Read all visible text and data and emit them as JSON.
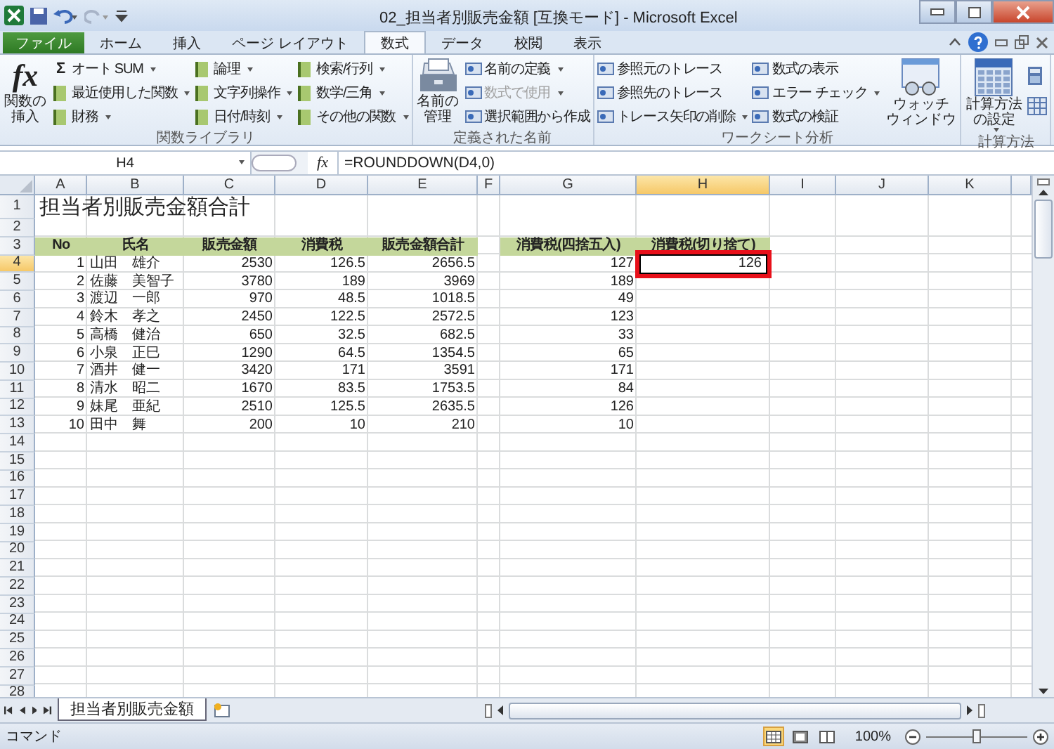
{
  "window": {
    "title": "02_担当者別販売金額 [互換モード] - Microsoft Excel"
  },
  "tabs": [
    {
      "label": "ファイル",
      "kind": "file",
      "selected": false
    },
    {
      "label": "ホーム",
      "kind": "tab",
      "selected": false
    },
    {
      "label": "挿入",
      "kind": "tab",
      "selected": false
    },
    {
      "label": "ページ レイアウト",
      "kind": "tab",
      "selected": false
    },
    {
      "label": "数式",
      "kind": "tab",
      "selected": true
    },
    {
      "label": "データ",
      "kind": "tab",
      "selected": false
    },
    {
      "label": "校閲",
      "kind": "tab",
      "selected": false
    },
    {
      "label": "表示",
      "kind": "tab",
      "selected": false
    }
  ],
  "ribbon": [
    {
      "label": "関数ライブラリ",
      "items": [
        {
          "kind": "large",
          "glyph": "fx",
          "lines": [
            "関数の",
            "挿入"
          ],
          "dropdown": false
        },
        {
          "kind": "column",
          "entries": [
            {
              "glyph": "Σ",
              "label": "オート SUM",
              "dropdown": true,
              "disabled": false
            },
            {
              "label": "最近使用した関数",
              "dropdown": true,
              "disabled": false
            },
            {
              "label": "財務",
              "dropdown": true,
              "disabled": false
            }
          ]
        },
        {
          "kind": "column",
          "entries": [
            {
              "label": "論理",
              "dropdown": true,
              "disabled": false
            },
            {
              "label": "文字列操作",
              "dropdown": true,
              "disabled": false
            },
            {
              "label": "日付/時刻",
              "dropdown": true,
              "disabled": false
            }
          ]
        },
        {
          "kind": "column",
          "entries": [
            {
              "label": "検索/行列",
              "dropdown": true,
              "disabled": false
            },
            {
              "label": "数学/三角",
              "dropdown": true,
              "disabled": false
            },
            {
              "label": "その他の関数",
              "dropdown": true,
              "disabled": false
            }
          ]
        }
      ]
    },
    {
      "label": "定義された名前",
      "items": [
        {
          "kind": "large",
          "lines": [
            "名前の",
            "管理"
          ],
          "dropdown": false
        },
        {
          "kind": "column",
          "entries": [
            {
              "label": "名前の定義",
              "dropdown": true,
              "disabled": false
            },
            {
              "label": "数式で使用",
              "dropdown": true,
              "disabled": true
            },
            {
              "label": "選択範囲から作成",
              "dropdown": false,
              "disabled": false
            }
          ]
        }
      ]
    },
    {
      "label": "ワークシート分析",
      "items": [
        {
          "kind": "column",
          "entries": [
            {
              "label": "参照元のトレース",
              "dropdown": false,
              "disabled": false
            },
            {
              "label": "参照先のトレース",
              "dropdown": false,
              "disabled": false
            },
            {
              "label": "トレース矢印の削除",
              "dropdown": true,
              "disabled": false
            }
          ]
        },
        {
          "kind": "column",
          "entries": [
            {
              "label": "数式の表示",
              "dropdown": false,
              "disabled": false
            },
            {
              "label": "エラー チェック",
              "dropdown": true,
              "disabled": false
            },
            {
              "label": "数式の検証",
              "dropdown": false,
              "disabled": false
            }
          ]
        },
        {
          "kind": "large",
          "lines": [
            "ウォッチ",
            "ウィンドウ"
          ],
          "dropdown": false
        }
      ]
    },
    {
      "label": "計算方法",
      "items": [
        {
          "kind": "large",
          "lines": [
            "計算方法",
            "の設定"
          ],
          "dropdown": true
        },
        {
          "kind": "icons"
        }
      ]
    }
  ],
  "formula_bar": {
    "name_box": "H4",
    "fx_label": "fx",
    "formula": "=ROUNDDOWN(D4,0)"
  },
  "sheet": {
    "columns": [
      {
        "label": "A",
        "selected": false
      },
      {
        "label": "B",
        "selected": false
      },
      {
        "label": "C",
        "selected": false
      },
      {
        "label": "D",
        "selected": false
      },
      {
        "label": "E",
        "selected": false
      },
      {
        "label": "F",
        "selected": false
      },
      {
        "label": "G",
        "selected": false
      },
      {
        "label": "H",
        "selected": true
      },
      {
        "label": "I",
        "selected": false
      },
      {
        "label": "J",
        "selected": false
      },
      {
        "label": "K",
        "selected": false
      }
    ],
    "rows": [
      {
        "label": "1",
        "selected": false
      },
      {
        "label": "2",
        "selected": false
      },
      {
        "label": "3",
        "selected": false
      },
      {
        "label": "4",
        "selected": true
      },
      {
        "label": "5",
        "selected": false
      },
      {
        "label": "6",
        "selected": false
      },
      {
        "label": "7",
        "selected": false
      },
      {
        "label": "8",
        "selected": false
      },
      {
        "label": "9",
        "selected": false
      },
      {
        "label": "10",
        "selected": false
      },
      {
        "label": "11",
        "selected": false
      },
      {
        "label": "12",
        "selected": false
      },
      {
        "label": "13",
        "selected": false
      },
      {
        "label": "14",
        "selected": false
      },
      {
        "label": "15",
        "selected": false
      },
      {
        "label": "16",
        "selected": false
      },
      {
        "label": "17",
        "selected": false
      },
      {
        "label": "18",
        "selected": false
      },
      {
        "label": "19",
        "selected": false
      },
      {
        "label": "20",
        "selected": false
      },
      {
        "label": "21",
        "selected": false
      },
      {
        "label": "22",
        "selected": false
      },
      {
        "label": "23",
        "selected": false
      },
      {
        "label": "24",
        "selected": false
      },
      {
        "label": "25",
        "selected": false
      },
      {
        "label": "26",
        "selected": false
      },
      {
        "label": "27",
        "selected": false
      },
      {
        "label": "28",
        "selected": false
      }
    ],
    "title": "担当者別販売金額合計",
    "table": {
      "columns": [
        "No",
        "氏名",
        "販売金額",
        "消費税",
        "販売金額合計"
      ],
      "rows": [
        [
          "1",
          "山田　雄介",
          "2530",
          "126.5",
          "2656.5"
        ],
        [
          "2",
          "佐藤　美智子",
          "3780",
          "189",
          "3969"
        ],
        [
          "3",
          "渡辺　一郎",
          "970",
          "48.5",
          "1018.5"
        ],
        [
          "4",
          "鈴木　孝之",
          "2450",
          "122.5",
          "2572.5"
        ],
        [
          "5",
          "高橋　健治",
          "650",
          "32.5",
          "682.5"
        ],
        [
          "6",
          "小泉　正巳",
          "1290",
          "64.5",
          "1354.5"
        ],
        [
          "7",
          "酒井　健一",
          "3420",
          "171",
          "3591"
        ],
        [
          "8",
          "清水　昭二",
          "1670",
          "83.5",
          "1753.5"
        ],
        [
          "9",
          "妹尾　亜紀",
          "2510",
          "125.5",
          "2635.5"
        ],
        [
          "10",
          "田中　舞",
          "200",
          "10",
          "210"
        ]
      ]
    },
    "side_table": {
      "columns": [
        "消費税(四捨五入)",
        "消費税(切り捨て)"
      ],
      "rows": [
        [
          {
            "text": "127",
            "selected": false
          },
          {
            "text": "126",
            "selected": true
          }
        ],
        [
          {
            "text": "189",
            "selected": false
          }
        ],
        [
          {
            "text": "49",
            "selected": false
          }
        ],
        [
          {
            "text": "123",
            "selected": false
          }
        ],
        [
          {
            "text": "33",
            "selected": false
          }
        ],
        [
          {
            "text": "65",
            "selected": false
          }
        ],
        [
          {
            "text": "171",
            "selected": false
          }
        ],
        [
          {
            "text": "84",
            "selected": false
          }
        ],
        [
          {
            "text": "126",
            "selected": false
          }
        ],
        [
          {
            "text": "10",
            "selected": false
          }
        ]
      ]
    }
  },
  "sheet_tabs": [
    {
      "label": "担当者別販売金額",
      "selected": true
    }
  ],
  "status_bar": {
    "mode": "コマンド",
    "views": [
      {
        "selected": true
      },
      {
        "selected": false
      },
      {
        "selected": false
      }
    ],
    "zoom": "100%",
    "level": 0.5
  }
}
